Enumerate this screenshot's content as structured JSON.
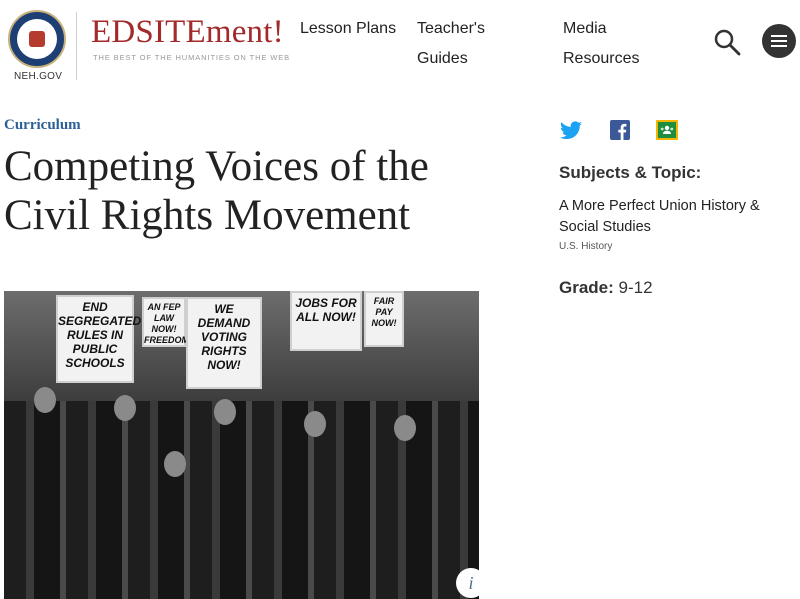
{
  "header": {
    "logo_text": "EDSITEment!",
    "logo_tagline": "THE BEST OF THE HUMANITIES ON THE WEB",
    "neh_label": "NEH.GOV",
    "nav": [
      {
        "label": "Lesson Plans"
      },
      {
        "label": "Teacher's Guides"
      },
      {
        "label": "Media Resources"
      }
    ]
  },
  "main": {
    "category": "Curriculum",
    "title": "Competing Voices of the Civil Rights Movement",
    "hero_signs": [
      "END SEGREGATED RULES IN PUBLIC SCHOOLS",
      "AN FEP LAW NOW! FREEDOM",
      "WE DEMAND VOTING RIGHTS NOW!",
      "JOBS FOR ALL NOW!",
      "FAIR PAY NOW!"
    ],
    "info_label": "i"
  },
  "sidebar": {
    "share_icons": [
      "twitter-icon",
      "facebook-icon",
      "google-classroom-icon"
    ],
    "subjects_heading": "Subjects & Topic:",
    "subjects_primary": "A More Perfect Union History & Social Studies",
    "subjects_secondary": "U.S. History",
    "grade_label": "Grade:",
    "grade_value": "9-12"
  },
  "colors": {
    "brand_red": "#a32a2a",
    "category_blue": "#2c5f96",
    "twitter_blue": "#1da1f2",
    "facebook_blue": "#3b5998",
    "classroom_green": "#1e8e3e"
  }
}
